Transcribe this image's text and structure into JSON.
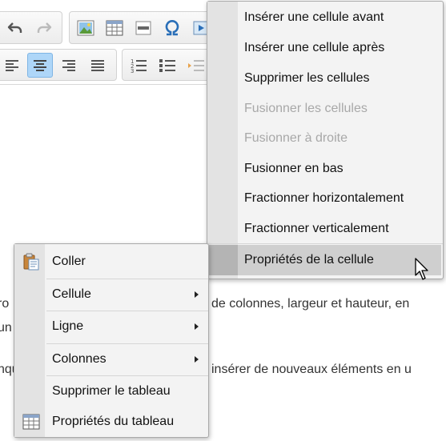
{
  "toolbar": {
    "row1": [
      {
        "name": "undo-icon"
      },
      {
        "name": "redo-icon"
      },
      {
        "name": "image-icon"
      },
      {
        "name": "table-icon"
      },
      {
        "name": "horizontal-line-icon"
      },
      {
        "name": "omega-icon"
      },
      {
        "name": "media-icon"
      }
    ],
    "row2": [
      {
        "name": "align-left-icon"
      },
      {
        "name": "align-center-icon",
        "active": true
      },
      {
        "name": "align-right-icon"
      },
      {
        "name": "align-justify-icon"
      },
      {
        "name": "numbered-list-icon"
      },
      {
        "name": "bulleted-list-icon"
      },
      {
        "name": "indent-icon"
      }
    ]
  },
  "document": {
    "line1_left": "ro",
    "line1_right": "de colonnes, largeur et hauteur, en",
    "line2_left": "un",
    "line3_left": "nqu",
    "line3_right": "insérer de nouveaux éléments en u"
  },
  "cell_submenu": {
    "items": [
      {
        "label": "Insérer une cellule avant",
        "disabled": false
      },
      {
        "label": "Insérer une cellule après",
        "disabled": false
      },
      {
        "label": "Supprimer les cellules",
        "disabled": false
      },
      {
        "label": "Fusionner les cellules",
        "disabled": true
      },
      {
        "label": "Fusionner à droite",
        "disabled": true
      },
      {
        "label": "Fusionner en bas",
        "disabled": false
      },
      {
        "label": "Fractionner horizontalement",
        "disabled": false
      },
      {
        "label": "Fractionner verticalement",
        "disabled": false
      },
      {
        "label": "Propriétés de la cellule",
        "disabled": false,
        "hover": true
      }
    ]
  },
  "context_menu": {
    "items": [
      {
        "label": "Coller",
        "icon": "paste-icon"
      },
      {
        "label": "Cellule",
        "submenu": true
      },
      {
        "label": "Ligne",
        "submenu": true
      },
      {
        "label": "Colonnes",
        "submenu": true
      },
      {
        "label": "Supprimer le tableau"
      },
      {
        "label": "Propriétés du tableau",
        "icon": "table-properties-icon"
      }
    ]
  }
}
